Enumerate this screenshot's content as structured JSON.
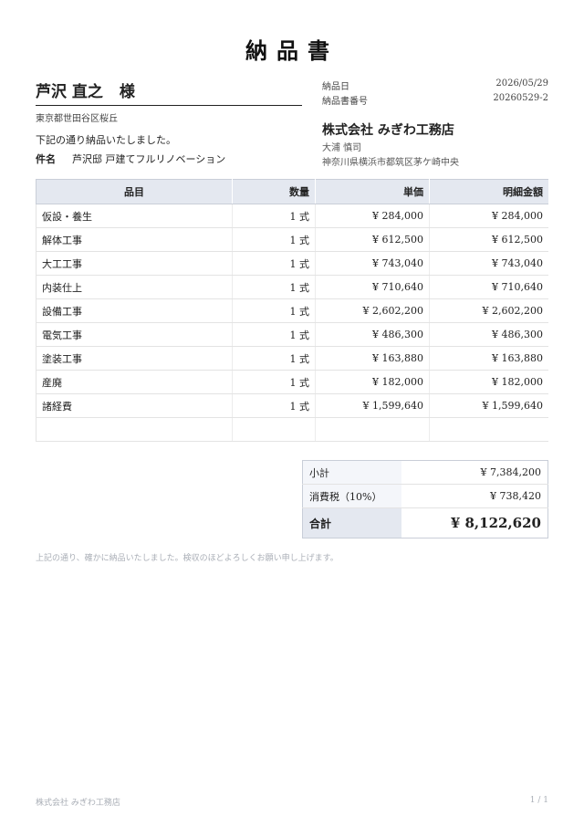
{
  "document": {
    "title": "納品書"
  },
  "recipient": {
    "name": "芦沢 直之",
    "honorific": "様",
    "address": "東京都世田谷区桜丘"
  },
  "intro": "下記の通り納品いたしました。",
  "subject": {
    "label": "件名",
    "value": "芦沢邸 戸建てフルリノベーション"
  },
  "meta": {
    "date_label": "納品日",
    "date": "2026/05/29",
    "number_label": "納品書番号",
    "number": "20260529-2"
  },
  "issuer": {
    "company": "株式会社 みぎわ工務店",
    "representative": "大浦 慎司",
    "address": "神奈川県横浜市都筑区茅ケ崎中央"
  },
  "table": {
    "headers": [
      "品目",
      "数量",
      "単価",
      "明細金額"
    ],
    "rows": [
      [
        "仮設・養生",
        "1 式",
        "¥ 284,000",
        "¥ 284,000"
      ],
      [
        "解体工事",
        "1 式",
        "¥ 612,500",
        "¥ 612,500"
      ],
      [
        "大工工事",
        "1 式",
        "¥ 743,040",
        "¥ 743,040"
      ],
      [
        "内装仕上",
        "1 式",
        "¥ 710,640",
        "¥ 710,640"
      ],
      [
        "設備工事",
        "1 式",
        "¥ 2,602,200",
        "¥ 2,602,200"
      ],
      [
        "電気工事",
        "1 式",
        "¥ 486,300",
        "¥ 486,300"
      ],
      [
        "塗装工事",
        "1 式",
        "¥ 163,880",
        "¥ 163,880"
      ],
      [
        "産廃",
        "1 式",
        "¥ 182,000",
        "¥ 182,000"
      ],
      [
        "諸経費",
        "1 式",
        "¥ 1,599,640",
        "¥ 1,599,640"
      ],
      [
        "",
        "",
        "",
        ""
      ]
    ]
  },
  "totals": {
    "subtotal_label": "小計",
    "subtotal": "¥ 7,384,200",
    "tax_label": "消費税（10%）",
    "tax": "¥ 738,420",
    "total_label": "合計",
    "total": "¥ 8,122,620"
  },
  "note": "上記の通り、確かに納品いたしました。検収のほどよろしくお願い申し上げます。",
  "footer": {
    "company": "株式会社 みぎわ工務店",
    "page": "1 / 1"
  }
}
